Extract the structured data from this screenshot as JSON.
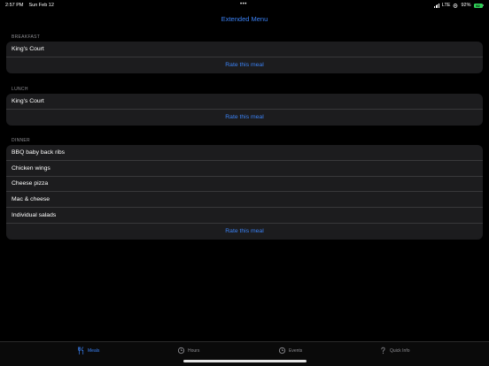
{
  "status_bar": {
    "time": "2:57 PM",
    "date": "Sun Feb 12",
    "multitask_dots": "•••",
    "network": "LTE",
    "battery_percent": "92%",
    "battery_level": "92"
  },
  "nav": {
    "title": "Extended Menu"
  },
  "sections": {
    "breakfast": {
      "header": "BREAKFAST",
      "items": [
        "King's Court"
      ],
      "rate_label": "Rate this meal"
    },
    "lunch": {
      "header": "LUNCH",
      "items": [
        "King's Court"
      ],
      "rate_label": "Rate this meal"
    },
    "dinner": {
      "header": "DINNER",
      "items": [
        "BBQ baby back ribs",
        "Chicken wings",
        "Cheese pizza",
        "Mac & cheese",
        "Individual salads"
      ],
      "rate_label": "Rate this meal"
    }
  },
  "tab_bar": {
    "tabs": [
      {
        "label": "Meals",
        "icon": "fork-knife-icon",
        "active": true
      },
      {
        "label": "Hours",
        "icon": "clock-icon",
        "active": false
      },
      {
        "label": "Events",
        "icon": "clock-icon",
        "active": false
      },
      {
        "label": "Quick Info",
        "icon": "question-icon",
        "active": false
      }
    ]
  },
  "colors": {
    "accent": "#3b82f6",
    "background": "#000000",
    "card": "#1c1c1e",
    "secondary_text": "#8e8e93",
    "battery": "#30d158"
  }
}
